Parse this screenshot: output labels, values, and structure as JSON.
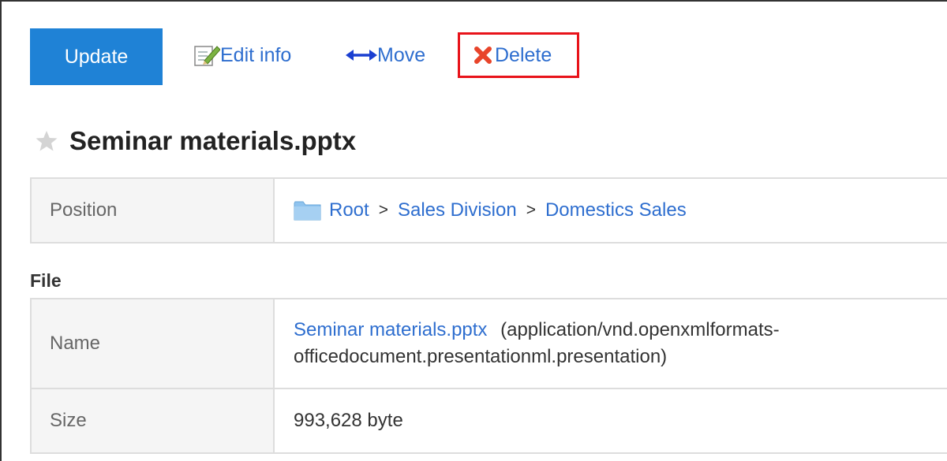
{
  "toolbar": {
    "update_label": "Update",
    "edit_label": "Edit info",
    "move_label": "Move",
    "delete_label": "Delete"
  },
  "file_title": "Seminar materials.pptx",
  "position": {
    "header": "Position",
    "crumbs": [
      "Root",
      "Sales Division",
      "Domestics Sales"
    ],
    "separator": ">"
  },
  "file_section": {
    "label": "File",
    "name_header": "Name",
    "file_name": "Seminar materials.pptx",
    "mime_line1": "(application/vnd.openxmlformats-",
    "mime_line2": "officedocument.presentationml.presentation)",
    "size_header": "Size",
    "size_value": "993,628 byte"
  },
  "colors": {
    "accent": "#1f82d6",
    "link": "#2e6ecf",
    "highlight_border": "#e8131a",
    "delete_icon": "#e8442a"
  },
  "icons": {
    "edit": "edit-pencil-icon",
    "move": "horizontal-arrows-icon",
    "delete": "red-x-icon",
    "star": "star-icon",
    "folder": "folder-icon"
  }
}
